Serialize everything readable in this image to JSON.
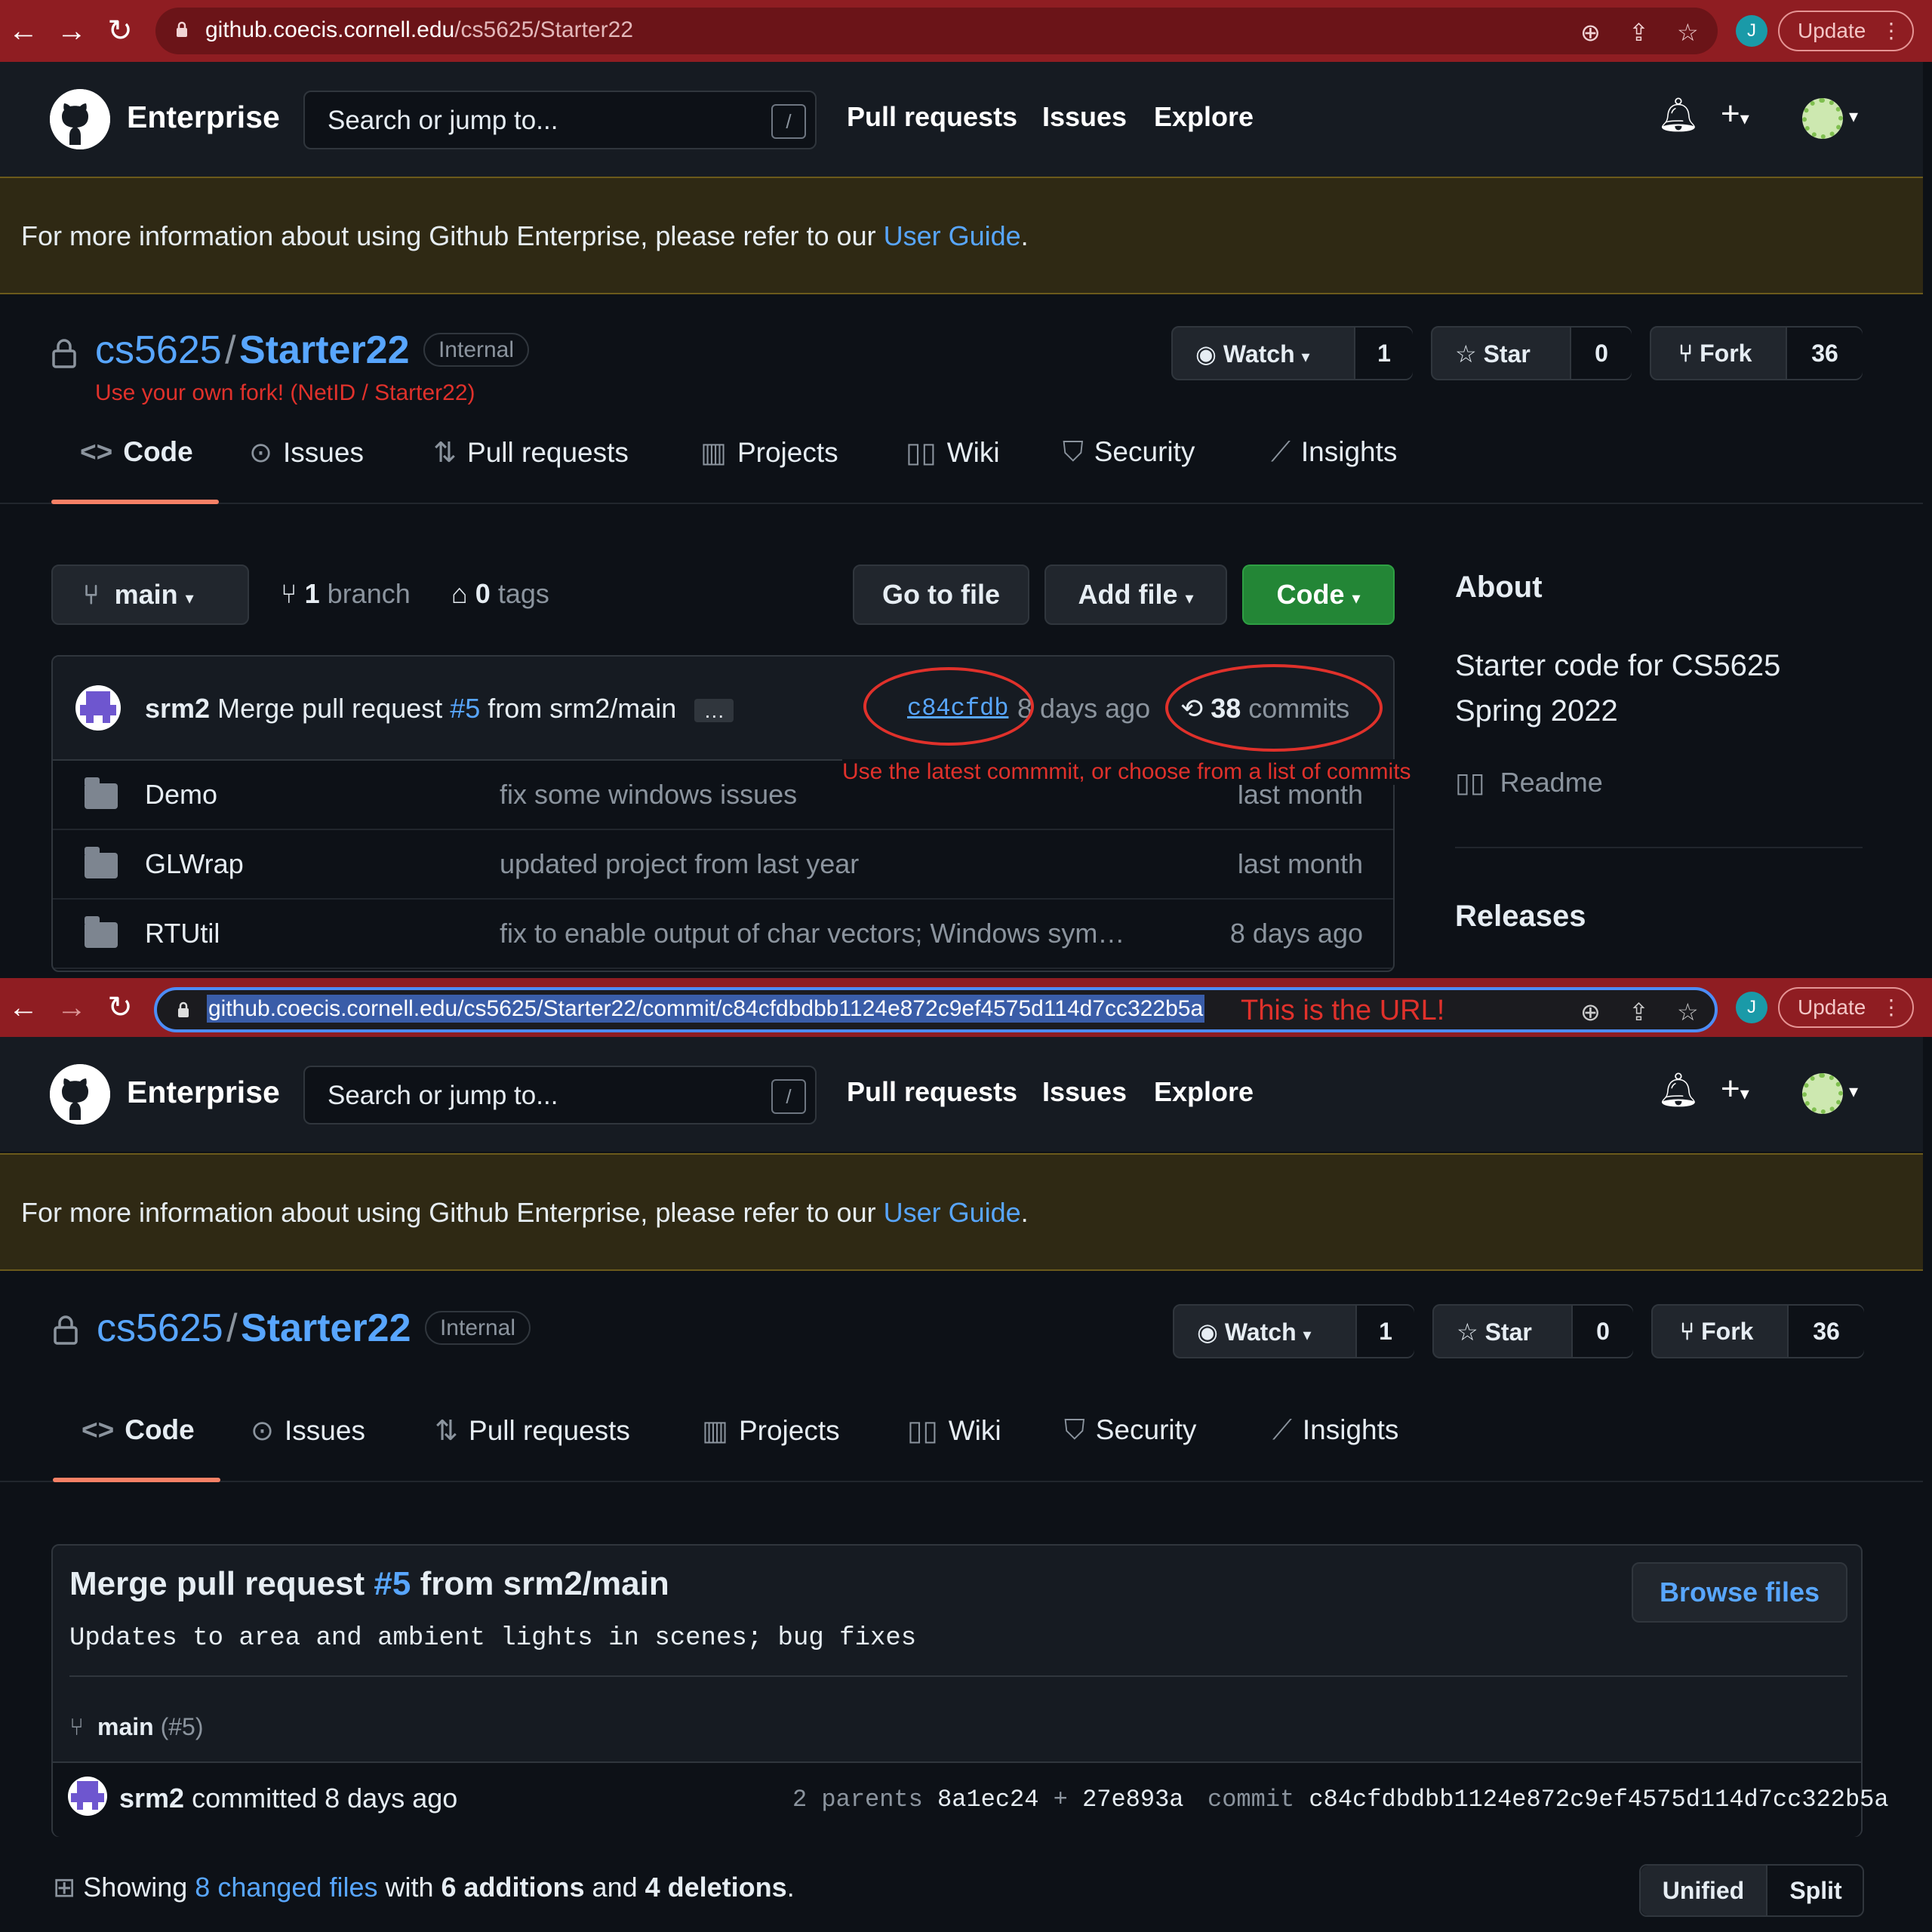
{
  "browser": {
    "top_url_host": "github.coecis.cornell.edu",
    "top_url_path": "/cs5625/Starter22",
    "bottom_url": "github.coecis.cornell.edu/cs5625/Starter22/commit/c84cfdbdbb1124e872c9ef4575d114d7cc322b5a",
    "profile_initial": "J",
    "update_label": "Update"
  },
  "header": {
    "brand": "Enterprise",
    "search_placeholder": "Search or jump to...",
    "slash": "/",
    "nav": [
      "Pull requests",
      "Issues",
      "Explore"
    ]
  },
  "banner": {
    "text": "For more information about using Github Enterprise, please refer to our ",
    "link": "User Guide",
    "after": "."
  },
  "repo": {
    "owner": "cs5625",
    "sep": "/",
    "name": "Starter22",
    "visibility": "Internal",
    "watch_label": "Watch",
    "watch_count": "1",
    "star_label": "Star",
    "star_count": "0",
    "fork_label": "Fork",
    "fork_count": "36"
  },
  "tabs": [
    "Code",
    "Issues",
    "Pull requests",
    "Projects",
    "Wiki",
    "Security",
    "Insights"
  ],
  "code_page": {
    "branch": "main",
    "branches_count": "1",
    "branches_label": "branch",
    "tags_count": "0",
    "tags_label": "tags",
    "go_to_file": "Go to file",
    "add_file": "Add file",
    "code_btn": "Code",
    "latest_commit": {
      "author": "srm2",
      "message_pre": "Merge pull request ",
      "pr": "#5",
      "message_post": " from srm2/main",
      "ellipsis": "…",
      "sha": "c84cfdb",
      "age": "8 days ago",
      "commits_count": "38",
      "commits_label": "commits"
    },
    "files": [
      {
        "name": "Demo",
        "message": "fix some windows issues",
        "age": "last month"
      },
      {
        "name": "GLWrap",
        "message": "updated project from last year",
        "age": "last month"
      },
      {
        "name": "RTUtil",
        "message": "fix to enable output of char vectors; Windows sym…",
        "age": "8 days ago"
      }
    ],
    "about": {
      "heading": "About",
      "description_line1": "Starter code for CS5625",
      "description_line2": "Spring 2022",
      "readme": "Readme",
      "releases": "Releases"
    }
  },
  "annotations": {
    "fork_note": "Use your own fork! (NetID / Starter22)",
    "commit_note": "Use the latest commmit, or choose from a list of commits",
    "url_note": "This is the URL!"
  },
  "commit_page": {
    "title_pre": "Merge pull request ",
    "title_pr": "#5",
    "title_post": " from srm2/main",
    "description": "Updates to area and ambient lights in scenes; bug fixes",
    "browse_files": "Browse files",
    "branch": "main",
    "branch_pr": "(#5)",
    "author": "srm2",
    "committed": "committed 8 days ago",
    "parents_label": "2 parents",
    "parent1": "8a1ec24",
    "plus": "+",
    "parent2": "27e893a",
    "commit_label": "commit",
    "full_sha": "c84cfdbdbb1124e872c9ef4575d114d7cc322b5a",
    "showing": "Showing ",
    "changed_files": "8 changed files",
    "with": " with ",
    "additions": "6 additions",
    "and": " and ",
    "deletions": "4 deletions",
    "period": ".",
    "unified": "Unified",
    "split": "Split"
  },
  "colors": {
    "browser_bar": "#8f1d22",
    "accent_link": "#58a6ff",
    "annotation": "#e0312b",
    "green_button": "#238636",
    "tab_underline": "#f78166"
  }
}
